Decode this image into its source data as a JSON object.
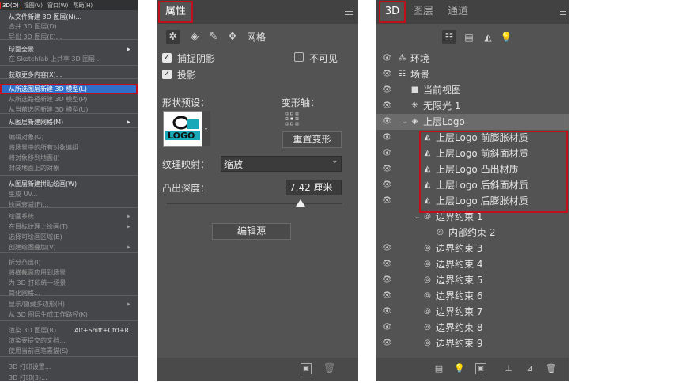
{
  "menu": {
    "bar": [
      "3D(D)",
      "视图(V)",
      "窗口(W)",
      "帮助(H)"
    ],
    "items": [
      {
        "label": "从文件新建 3D 图层(N)...",
        "state": "normal"
      },
      {
        "label": "合并 3D 图层(D)",
        "state": "disabled"
      },
      {
        "label": "导出 3D 图层(E)...",
        "state": "disabled"
      },
      {
        "label": "球面全景",
        "state": "normal",
        "submenu": true
      },
      {
        "label": "在 Sketchfab 上共享 3D 图层...",
        "state": "disabled"
      },
      {
        "label": "获取更多内容(X)...",
        "state": "normal"
      },
      {
        "label": "从所选图层新建 3D 模型(L)",
        "state": "highlighted"
      },
      {
        "label": "从所选路径新建 3D 模型(P)",
        "state": "disabled"
      },
      {
        "label": "从当前选区新建 3D 模型(U)",
        "state": "disabled"
      },
      {
        "label": "从图层新建网格(M)",
        "state": "normal",
        "submenu": true
      },
      {
        "label": "编辑对象(G)",
        "state": "disabled"
      },
      {
        "label": "将场景中的所有对象编组",
        "state": "disabled"
      },
      {
        "label": "将对象移到地面(J)",
        "state": "disabled"
      },
      {
        "label": "封装地面上的对象",
        "state": "disabled"
      },
      {
        "label": "从图层新建拼贴绘画(W)",
        "state": "normal"
      },
      {
        "label": "生成 UV...",
        "state": "disabled"
      },
      {
        "label": "绘画衰减(F)...",
        "state": "disabled"
      },
      {
        "label": "绘画系统",
        "state": "disabled",
        "submenu": true
      },
      {
        "label": "在目标纹理上绘画(T)",
        "state": "disabled",
        "submenu": true
      },
      {
        "label": "选择可绘画区域(B)",
        "state": "disabled"
      },
      {
        "label": "创建绘图叠加(V)",
        "state": "disabled",
        "submenu": true
      },
      {
        "label": "拆分凸出(I)",
        "state": "disabled"
      },
      {
        "label": "将横截面应用到场景",
        "state": "disabled"
      },
      {
        "label": "为 3D 打印统一场景",
        "state": "disabled"
      },
      {
        "label": "简化网格...",
        "state": "disabled"
      },
      {
        "label": "显示/隐藏多边形(H)",
        "state": "disabled",
        "submenu": true
      },
      {
        "label": "从 3D 图层生成工作路径(K)",
        "state": "disabled"
      },
      {
        "label": "渲染 3D 图层(R)",
        "state": "disabled",
        "shortcut": "Alt+Shift+Ctrl+R"
      },
      {
        "label": "渲染要提交的文档...",
        "state": "disabled"
      },
      {
        "label": "使用当前画笔素描(S)",
        "state": "disabled"
      },
      {
        "label": "3D 打印设置...",
        "state": "disabled"
      },
      {
        "label": "3D 打印(3)...",
        "state": "disabled"
      }
    ]
  },
  "properties": {
    "tab_label": "属性",
    "mesh_label": "网格",
    "catch_shadows": "捕捉阴影",
    "invisible": "不可见",
    "cast_shadows": "投影",
    "shape_preset_label": "形状预设：",
    "deform_axis_label": "变形轴：",
    "reset_deform": "重置变形",
    "texture_mapping_label": "纹理映射：",
    "texture_mapping_value": "缩放",
    "extrusion_depth_label": "凸出深度：",
    "extrusion_depth_value": "7.42 厘米",
    "extrusion_slider_fraction": 0.76,
    "edit_source": "编辑源",
    "preview_text": "LOGO"
  },
  "panel3d": {
    "tabs": [
      "3D",
      "图层",
      "通道"
    ],
    "rows": [
      {
        "label": "环境",
        "icon": "environment-icon",
        "glyph": "⁂",
        "indent": 0,
        "eye": true
      },
      {
        "label": "场景",
        "icon": "scene-icon",
        "glyph": "☷",
        "indent": 0,
        "eye": true
      },
      {
        "label": "当前视图",
        "icon": "camera-icon",
        "glyph": "■",
        "indent": 1,
        "eye": true
      },
      {
        "label": "无限光 1",
        "icon": "infinite-light-icon",
        "glyph": "✳",
        "indent": 1,
        "eye": true
      },
      {
        "label": "上层Logo",
        "icon": "mesh-icon",
        "glyph": "◈",
        "indent": 1,
        "eye": true,
        "selected": true,
        "twirl": true
      },
      {
        "label": "上层Logo 前膨胀材质",
        "icon": "material-icon",
        "glyph": "◭",
        "indent": 2,
        "eye": true
      },
      {
        "label": "上层Logo 前斜面材质",
        "icon": "material-icon",
        "glyph": "◭",
        "indent": 2,
        "eye": true
      },
      {
        "label": "上层Logo 凸出材质",
        "icon": "material-icon",
        "glyph": "◭",
        "indent": 2,
        "eye": true
      },
      {
        "label": "上层Logo 后斜面材质",
        "icon": "material-icon",
        "glyph": "◭",
        "indent": 2,
        "eye": true
      },
      {
        "label": "上层Logo 后膨胀材质",
        "icon": "material-icon",
        "glyph": "◭",
        "indent": 2,
        "eye": true
      },
      {
        "label": "边界约束 1",
        "icon": "constraint-icon",
        "glyph": "◎",
        "indent": 2,
        "eye": false,
        "twirl": true
      },
      {
        "label": "内部约束 2",
        "icon": "constraint-icon",
        "glyph": "◎",
        "indent": 3,
        "eye": false
      },
      {
        "label": "边界约束 3",
        "icon": "constraint-icon",
        "glyph": "◎",
        "indent": 2,
        "eye": true
      },
      {
        "label": "边界约束 4",
        "icon": "constraint-icon",
        "glyph": "◎",
        "indent": 2,
        "eye": true
      },
      {
        "label": "边界约束 5",
        "icon": "constraint-icon",
        "glyph": "◎",
        "indent": 2,
        "eye": true
      },
      {
        "label": "边界约束 6",
        "icon": "constraint-icon",
        "glyph": "◎",
        "indent": 2,
        "eye": true
      },
      {
        "label": "边界约束 7",
        "icon": "constraint-icon",
        "glyph": "◎",
        "indent": 2,
        "eye": true
      },
      {
        "label": "边界约束 8",
        "icon": "constraint-icon",
        "glyph": "◎",
        "indent": 2,
        "eye": true
      },
      {
        "label": "边界约束 9",
        "icon": "constraint-icon",
        "glyph": "◎",
        "indent": 2,
        "eye": true
      }
    ]
  },
  "colors": {
    "highlight_blue": "#2f6fc9",
    "annotation_red": "#c0101c",
    "panel_gray": "#535353"
  }
}
